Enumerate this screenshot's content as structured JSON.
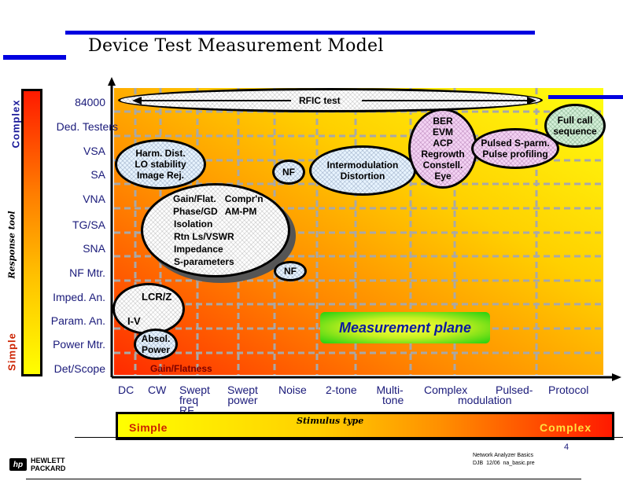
{
  "title": "Device Test Measurement Model",
  "colors": {
    "accent_blue": "#0000e0",
    "label_navy": "#1a1a7a",
    "simple_red": "#cc2200",
    "complex_yellow": "#ffe040",
    "measurement_plane_text": "#0a1aa0"
  },
  "left_scale": {
    "top_label": "Complex",
    "bottom_label": "Simple",
    "axis_title": "Response tool"
  },
  "bottom_scale": {
    "left_label": "Simple",
    "right_label": "Complex",
    "axis_title": "Stimulus type"
  },
  "response_tools": [
    "84000",
    "Ded. Testers",
    "VSA",
    "SA",
    "VNA",
    "TG/SA",
    "SNA",
    "NF Mtr.",
    "Imped. An.",
    "Param. An.",
    "Power Mtr.",
    "Det/Scope"
  ],
  "stimulus_types": [
    {
      "line1": "DC",
      "line2": ""
    },
    {
      "line1": "CW",
      "line2": ""
    },
    {
      "line1": "Swept",
      "line2": "freq"
    },
    {
      "line1": "RF",
      "line2": ""
    },
    {
      "line1": "Swept",
      "line2": "power"
    },
    {
      "line1": "Noise",
      "line2": ""
    },
    {
      "line1": "2-tone",
      "line2": ""
    },
    {
      "line1": "Multi-",
      "line2": "tone"
    },
    {
      "line1": "Complex",
      "line2": ""
    },
    {
      "line1": "Pulsed-",
      "line2": ""
    },
    {
      "line1": "modulation",
      "line2": ""
    },
    {
      "line1": "Protocol",
      "line2": ""
    }
  ],
  "measurements": {
    "rfic_test": "RFIC test",
    "harm_dist": [
      "Harm. Dist.",
      "LO stability",
      "Image Rej."
    ],
    "nf_top": "NF",
    "intermod": [
      "Intermodulation",
      "Distortion"
    ],
    "ber_group": [
      "BER",
      "EVM",
      "ACP",
      "Regrowth",
      "Constell.",
      "Eye"
    ],
    "pulsed": [
      "Pulsed S-parm.",
      "Pulse profiling"
    ],
    "full_call": [
      "Full call",
      "sequence"
    ],
    "gain_group": [
      [
        "Gain/Flat.",
        "Compr'n"
      ],
      [
        "Phase/GD",
        "AM-PM"
      ],
      [
        "Isolation",
        ""
      ],
      [
        "Rtn Ls/VSWR",
        ""
      ],
      [
        "Impedance",
        ""
      ],
      [
        "S-parameters",
        ""
      ]
    ],
    "nf_mid": "NF",
    "lcrz": "LCR/Z",
    "iv": "I-V",
    "absol_power": [
      "Absol.",
      "Power"
    ],
    "gain_flatness": "Gain/Flatness",
    "measurement_plane": "Measurement plane"
  },
  "footer": {
    "logo_line1": "HEWLETT",
    "logo_line2": "PACKARD",
    "logo_mark": "hp",
    "course": "Network Analyzer Basics",
    "ref": "DJB  12/06  na_basic.pre",
    "page": "4"
  }
}
